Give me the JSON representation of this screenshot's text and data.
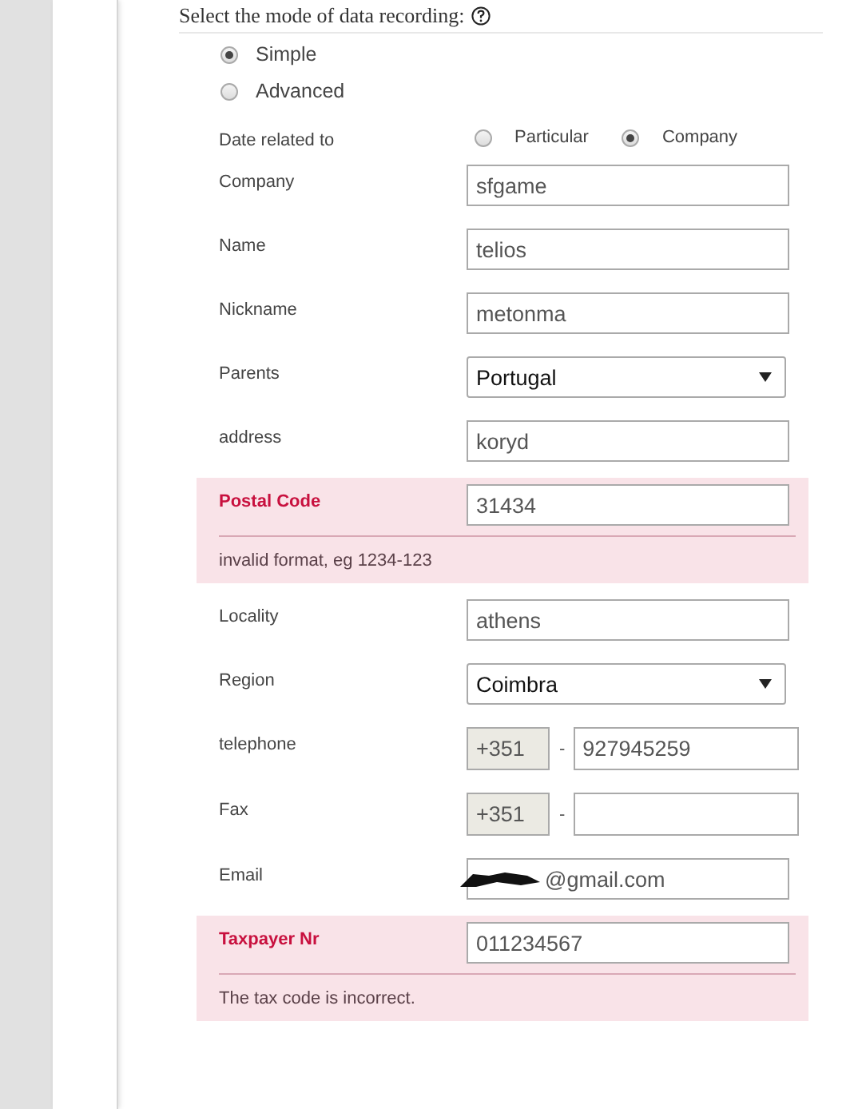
{
  "heading": {
    "text": "Select the mode of data recording:"
  },
  "modes": [
    {
      "label": "Simple",
      "selected": true
    },
    {
      "label": "Advanced",
      "selected": false
    }
  ],
  "date_related": {
    "label": "Date related to",
    "options": [
      {
        "label": "Particular",
        "selected": false
      },
      {
        "label": "Company",
        "selected": true
      }
    ]
  },
  "fields": [
    {
      "kind": "text",
      "label": "Company",
      "value": "sfgame"
    },
    {
      "kind": "text",
      "label": "Name",
      "value": "telios"
    },
    {
      "kind": "text",
      "label": "Nickname",
      "value": "metonma"
    },
    {
      "kind": "select",
      "label": "Parents",
      "value": "Portugal"
    },
    {
      "kind": "text",
      "label": "address",
      "value": "koryd"
    },
    {
      "kind": "text",
      "label": "Postal Code",
      "value": "31434",
      "error": "invalid format, eg 1234-123"
    },
    {
      "kind": "text",
      "label": "Locality",
      "value": "athens"
    },
    {
      "kind": "select",
      "label": "Region",
      "value": "Coimbra"
    },
    {
      "kind": "phone",
      "label": "telephone",
      "prefix": "+351",
      "separator": "-",
      "value": "927945259"
    },
    {
      "kind": "phone",
      "label": "Fax",
      "prefix": "+351",
      "separator": "-"
    },
    {
      "kind": "text",
      "label": "Email",
      "value": "@gmail.com",
      "redacted": true
    },
    {
      "kind": "text",
      "label": "Taxpayer Nr",
      "value": "011234567",
      "error": "The tax code is incorrect."
    }
  ]
}
